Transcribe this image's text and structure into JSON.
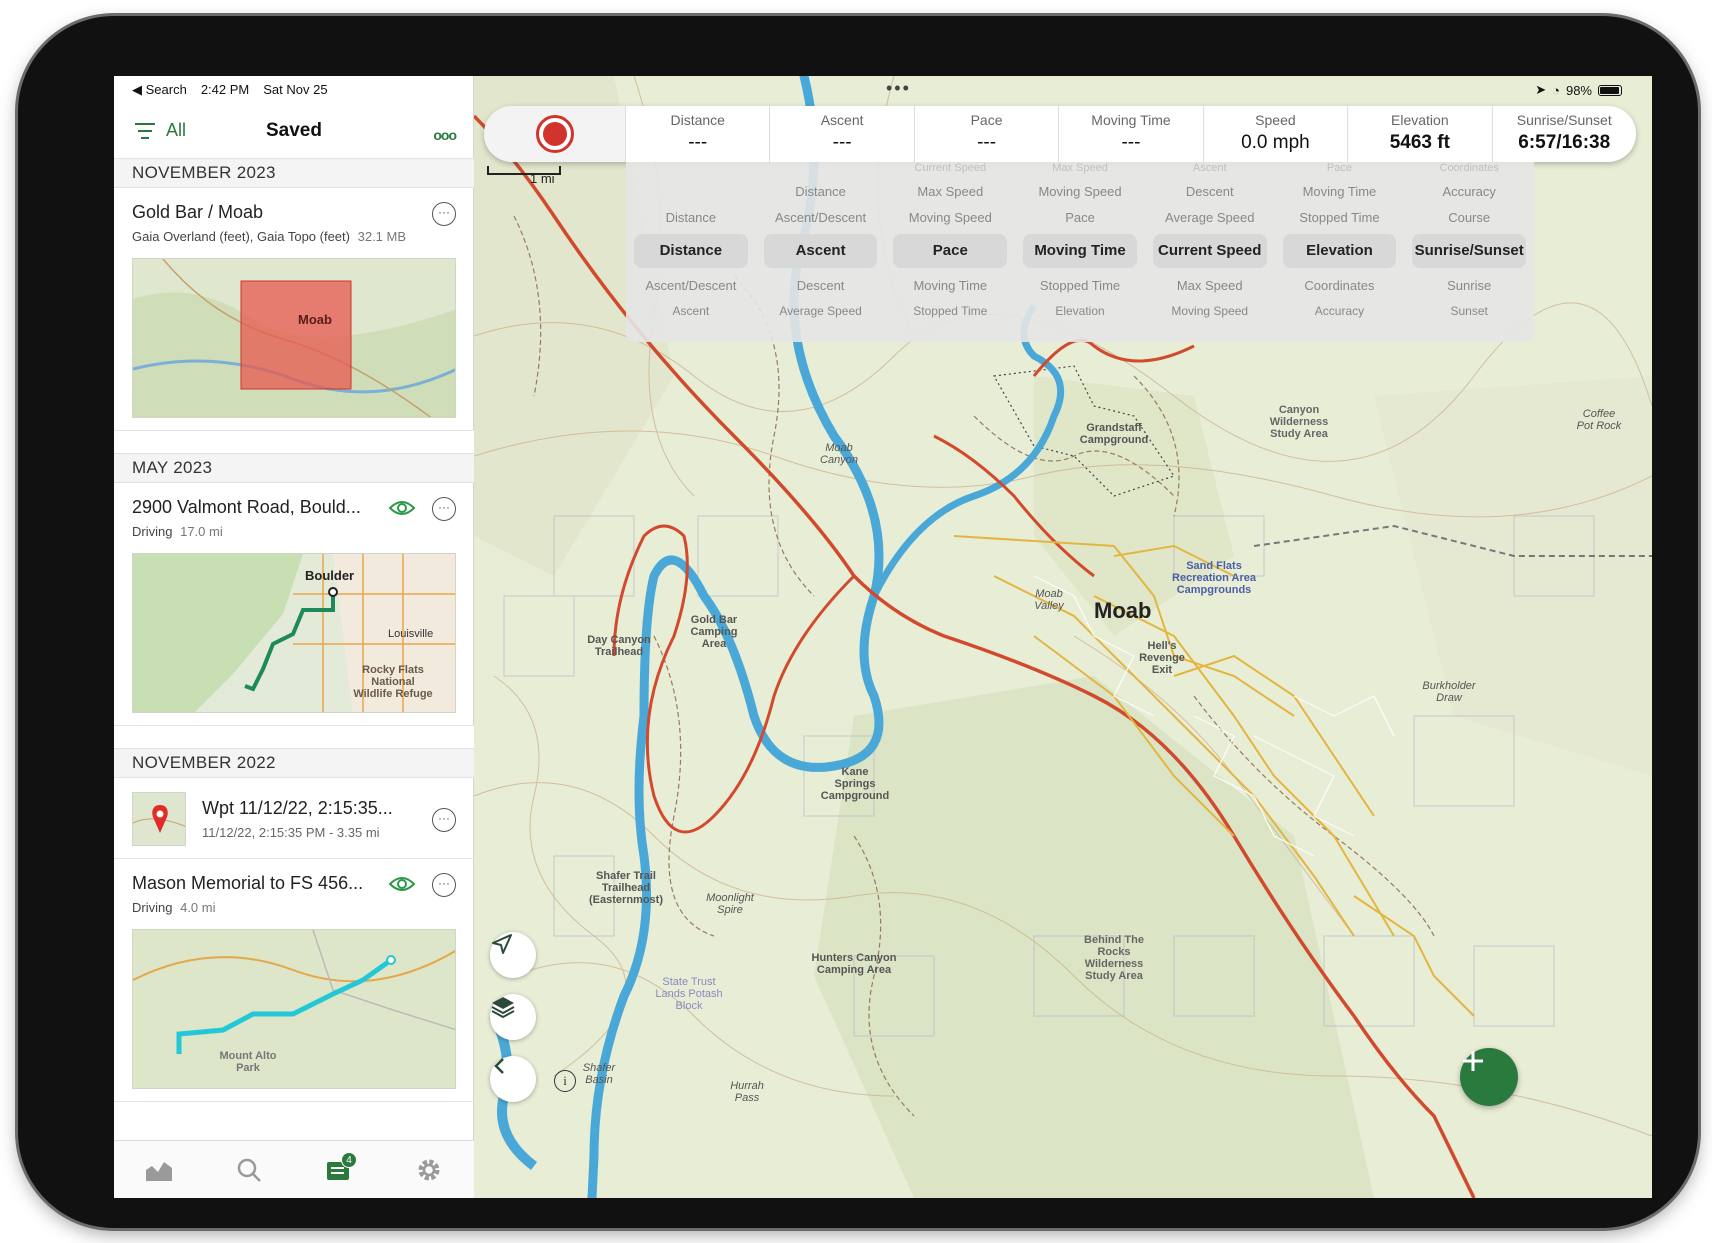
{
  "status": {
    "back_label": "◀ Search",
    "time": "2:42 PM",
    "date": "Sat Nov 25",
    "battery": "98%"
  },
  "sidebar": {
    "filter_label": "All",
    "title": "Saved",
    "sections": [
      {
        "heading": "NOVEMBER 2023",
        "item": {
          "title": "Gold Bar / Moab",
          "sub": "Gaia Overland (feet), Gaia Topo (feet)",
          "size": "32.1 MB",
          "map_label": "Moab"
        }
      },
      {
        "heading": "MAY 2023",
        "item": {
          "title": "2900 Valmont Road, Bould...",
          "type": "Driving",
          "distance": "17.0 mi",
          "map_label": "Boulder",
          "map_label_2": "Louisville",
          "map_label_3": "Rocky Flats National Wildlife Refuge"
        }
      },
      {
        "heading": "NOVEMBER 2022",
        "item": {
          "title": "Wpt 11/12/22, 2:15:35...",
          "sub": "11/12/22, 2:15:35 PM - 3.35 mi"
        }
      },
      {
        "heading": "",
        "item": {
          "title": "Mason Memorial to FS 456...",
          "type": "Driving",
          "distance": "4.0 mi",
          "map_label": "Mount Alto Park"
        }
      }
    ],
    "tabs": [
      {
        "name": "stats-icon"
      },
      {
        "name": "search-icon"
      },
      {
        "name": "saved-icon",
        "badge": "4"
      },
      {
        "name": "gear-icon"
      }
    ]
  },
  "stats": [
    {
      "label": "Distance",
      "value": "---"
    },
    {
      "label": "Ascent",
      "value": "---"
    },
    {
      "label": "Pace",
      "value": "---"
    },
    {
      "label": "Moving Time",
      "value": "---"
    },
    {
      "label": "Speed",
      "value": "0.0 mph"
    },
    {
      "label": "Elevation",
      "value": "5463 ft"
    },
    {
      "label": "Sunrise/Sunset",
      "value": "6:57/16:38"
    }
  ],
  "picker": [
    {
      "above": [
        "",
        "",
        "Distance"
      ],
      "selected": "Distance",
      "below": [
        "Ascent/Descent",
        "Ascent"
      ]
    },
    {
      "above": [
        "",
        "Distance",
        "Ascent/Descent"
      ],
      "selected": "Ascent",
      "below": [
        "Descent",
        "Average Speed"
      ]
    },
    {
      "above": [
        "Current Speed",
        "Max Speed",
        "Moving Speed"
      ],
      "selected": "Pace",
      "below": [
        "Moving Time",
        "Stopped Time"
      ]
    },
    {
      "above": [
        "Max Speed",
        "Moving Speed",
        "Pace"
      ],
      "selected": "Moving Time",
      "below": [
        "Stopped Time",
        "Elevation"
      ]
    },
    {
      "above": [
        "Ascent",
        "Descent",
        "Average Speed"
      ],
      "selected": "Current Speed",
      "below": [
        "Max Speed",
        "Moving Speed"
      ]
    },
    {
      "above": [
        "Pace",
        "Moving Time",
        "Stopped Time"
      ],
      "selected": "Elevation",
      "below": [
        "Coordinates",
        "Accuracy"
      ]
    },
    {
      "above": [
        "Coordinates",
        "Accuracy",
        "Course"
      ],
      "selected": "Sunrise/Sunset",
      "below": [
        "Sunrise",
        "Sunset"
      ]
    }
  ],
  "map": {
    "scale": "1 mi",
    "labels": {
      "moab": "Moab",
      "moab_valley": "Moab Valley",
      "gold_bar": "Gold Bar Camping Area",
      "day_canyon": "Day Canyon Trailhead",
      "kane_springs": "Kane Springs Campground",
      "shafer": "Shafer Trail Trailhead (Easternmost)",
      "hunters": "Hunters Canyon Camping Area",
      "state_trust": "State Trust Lands Potash Block",
      "behind_rocks": "Behind The Rocks Wilderness Study Area",
      "sand_flats": "Sand Flats Recreation Area Campgrounds",
      "grandstaff": "Grandstaff Campground",
      "canyon_wild": "Canyon Wilderness Study Area",
      "hells_revenge": "Hell's Revenge Exit",
      "burkholder": "Burkholder Draw",
      "hurrah": "Hurrah Pass",
      "shafer_basin": "Shafer Basin",
      "moonlight": "Moonlight Spire",
      "coffee_pot": "Coffee Pot Rock",
      "moab_canyon": "Moab Canyon"
    }
  },
  "colors": {
    "accent": "#2b7a3d",
    "record": "#d0342c",
    "river": "#4aa8d8",
    "highway": "#d24a2e",
    "road": "#e2b640"
  }
}
